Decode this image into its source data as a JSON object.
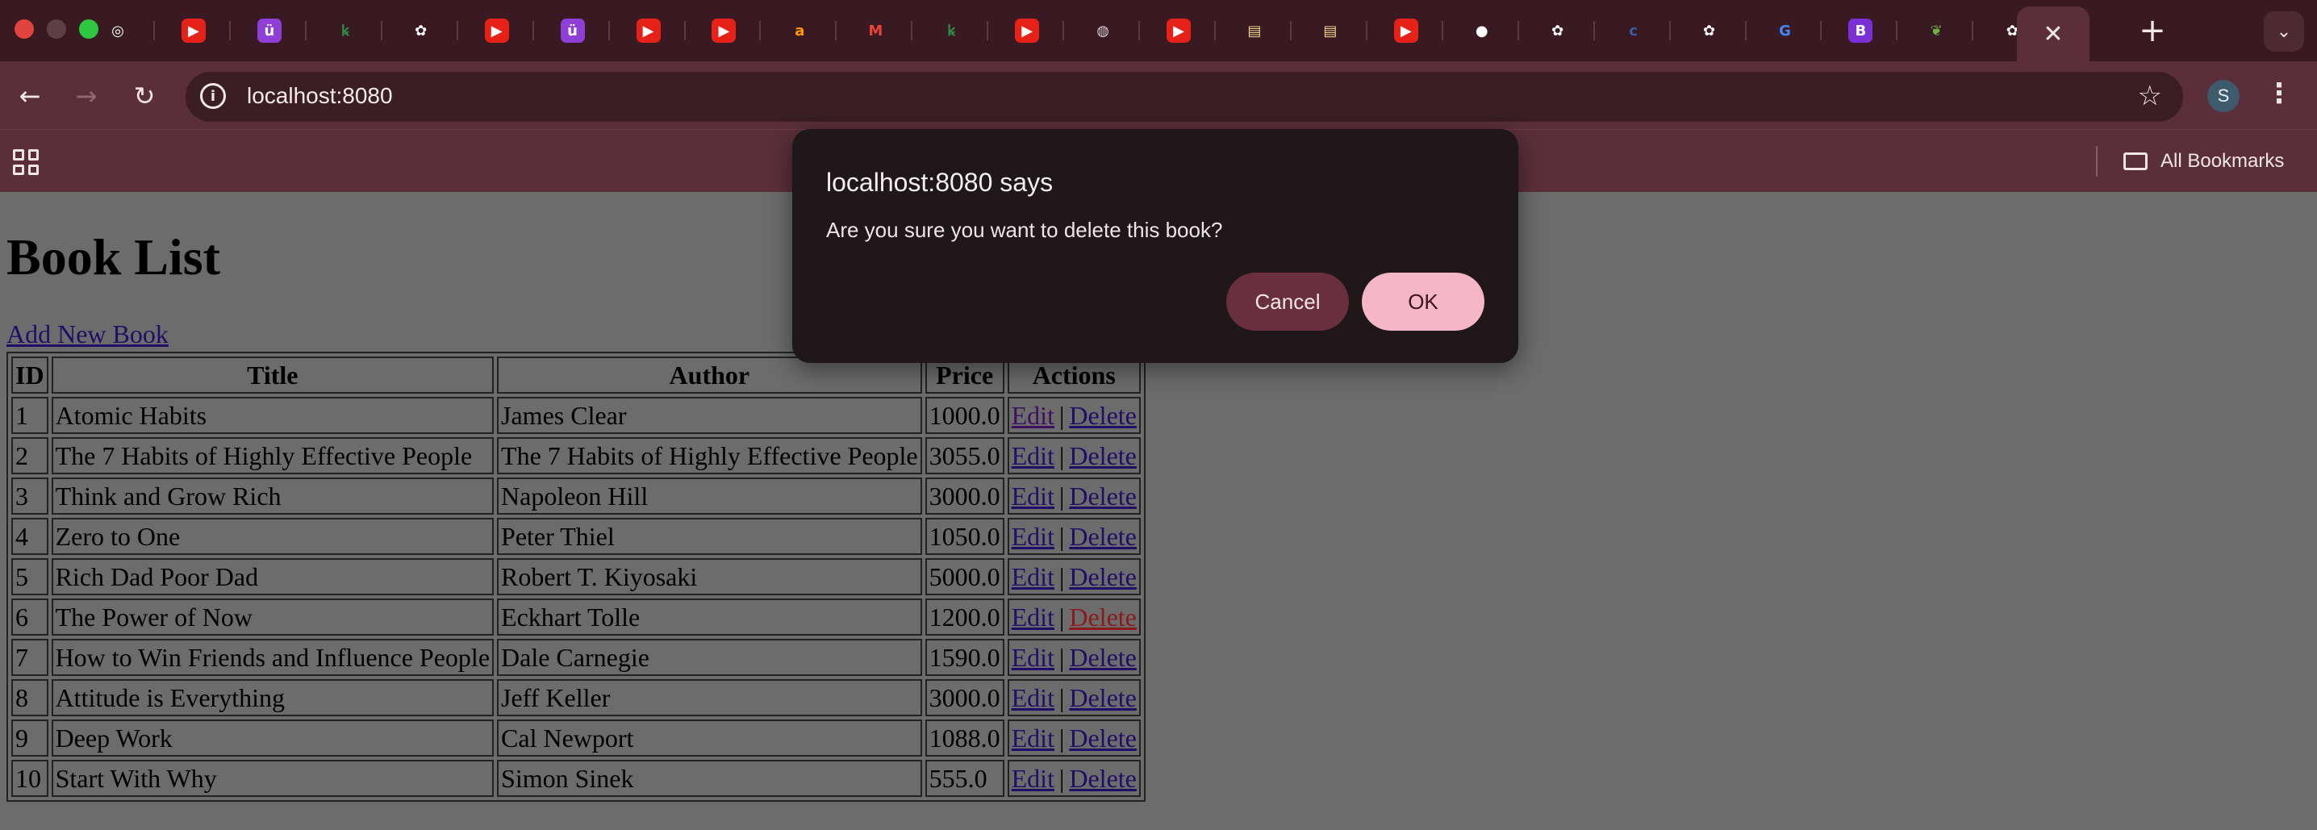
{
  "browser": {
    "tabs": [
      {
        "icon": "chrome-icon",
        "glyph": "◎",
        "color": "#ffffff"
      },
      {
        "icon": "youtube-icon",
        "glyph": "▶",
        "color": "#e62117"
      },
      {
        "icon": "udemy-icon",
        "glyph": "ü",
        "color": "#8f3fd6"
      },
      {
        "icon": "geeksforgeeks-icon",
        "glyph": "ꝃ",
        "color": "#2f8d46"
      },
      {
        "icon": "chatgpt-icon",
        "glyph": "✿",
        "color": "#ffffff"
      },
      {
        "icon": "youtube-icon",
        "glyph": "▶",
        "color": "#e62117"
      },
      {
        "icon": "udemy-icon",
        "glyph": "ü",
        "color": "#8f3fd6"
      },
      {
        "icon": "youtube-icon",
        "glyph": "▶",
        "color": "#e62117"
      },
      {
        "icon": "youtube-icon",
        "glyph": "▶",
        "color": "#e62117"
      },
      {
        "icon": "amazon-icon",
        "glyph": "a",
        "color": "#ff9900"
      },
      {
        "icon": "gmail-icon",
        "glyph": "M",
        "color": "#ea4335"
      },
      {
        "icon": "geeksforgeeks-icon",
        "glyph": "ꝃ",
        "color": "#2f8d46"
      },
      {
        "icon": "youtube-icon",
        "glyph": "▶",
        "color": "#e62117"
      },
      {
        "icon": "globe-icon",
        "glyph": "◍",
        "color": "#d0d0d0"
      },
      {
        "icon": "youtube-icon",
        "glyph": "▶",
        "color": "#e62117"
      },
      {
        "icon": "page-icon",
        "glyph": "▤",
        "color": "#f2d78a"
      },
      {
        "icon": "page-icon",
        "glyph": "▤",
        "color": "#f2d78a"
      },
      {
        "icon": "youtube-icon",
        "glyph": "▶",
        "color": "#e62117"
      },
      {
        "icon": "github-icon",
        "glyph": "●",
        "color": "#ffffff"
      },
      {
        "icon": "chatgpt-icon",
        "glyph": "✿",
        "color": "#ffffff"
      },
      {
        "icon": "code-icon",
        "glyph": "c",
        "color": "#3b5ba5"
      },
      {
        "icon": "chatgpt-icon",
        "glyph": "✿",
        "color": "#ffffff"
      },
      {
        "icon": "google-icon",
        "glyph": "G",
        "color": "#4285f4"
      },
      {
        "icon": "bootstrap-icon",
        "glyph": "B",
        "color": "#7b2fd6"
      },
      {
        "icon": "spring-icon",
        "glyph": "❦",
        "color": "#6db33f"
      },
      {
        "icon": "chatgpt-icon",
        "glyph": "✿",
        "color": "#ffffff"
      }
    ],
    "active_tab_close": "✕",
    "new_tab": "+",
    "tab_search": "⌄",
    "url": "localhost:8080",
    "profile_initial": "S",
    "all_bookmarks": "All Bookmarks"
  },
  "page": {
    "heading": "Book List",
    "add_link": "Add New Book",
    "columns": [
      "ID",
      "Title",
      "Author",
      "Price",
      "Actions"
    ],
    "rows": [
      {
        "id": "1",
        "title": "Atomic Habits",
        "author": "James Clear",
        "price": "1000.0",
        "edit": "Edit",
        "delete": "Delete"
      },
      {
        "id": "2",
        "title": "The 7 Habits of Highly Effective People",
        "author": "The 7 Habits of Highly Effective People",
        "price": "3055.0",
        "edit": "Edit",
        "delete": "Delete"
      },
      {
        "id": "3",
        "title": "Think and Grow Rich",
        "author": "Napoleon Hill",
        "price": "3000.0",
        "edit": "Edit",
        "delete": "Delete"
      },
      {
        "id": "4",
        "title": "Zero to One",
        "author": "Peter Thiel",
        "price": "1050.0",
        "edit": "Edit",
        "delete": "Delete"
      },
      {
        "id": "5",
        "title": "Rich Dad Poor Dad",
        "author": "Robert T. Kiyosaki",
        "price": "5000.0",
        "edit": "Edit",
        "delete": "Delete"
      },
      {
        "id": "6",
        "title": "The Power of Now",
        "author": "Eckhart Tolle",
        "price": "1200.0",
        "edit": "Edit",
        "delete": "Delete"
      },
      {
        "id": "7",
        "title": "How to Win Friends and Influence People",
        "author": "Dale Carnegie",
        "price": "1590.0",
        "edit": "Edit",
        "delete": "Delete"
      },
      {
        "id": "8",
        "title": "Attitude is Everything",
        "author": "Jeff Keller",
        "price": "3000.0",
        "edit": "Edit",
        "delete": "Delete"
      },
      {
        "id": "9",
        "title": "Deep Work",
        "author": "Cal Newport",
        "price": "1088.0",
        "edit": "Edit",
        "delete": "Delete"
      },
      {
        "id": "10",
        "title": "Start With Why",
        "author": "Simon Sinek",
        "price": "555.0",
        "edit": "Edit",
        "delete": "Delete"
      }
    ],
    "action_separator": "|"
  },
  "dialog": {
    "title": "localhost:8080 says",
    "message": "Are you sure you want to delete this book?",
    "cancel": "Cancel",
    "ok": "OK"
  }
}
